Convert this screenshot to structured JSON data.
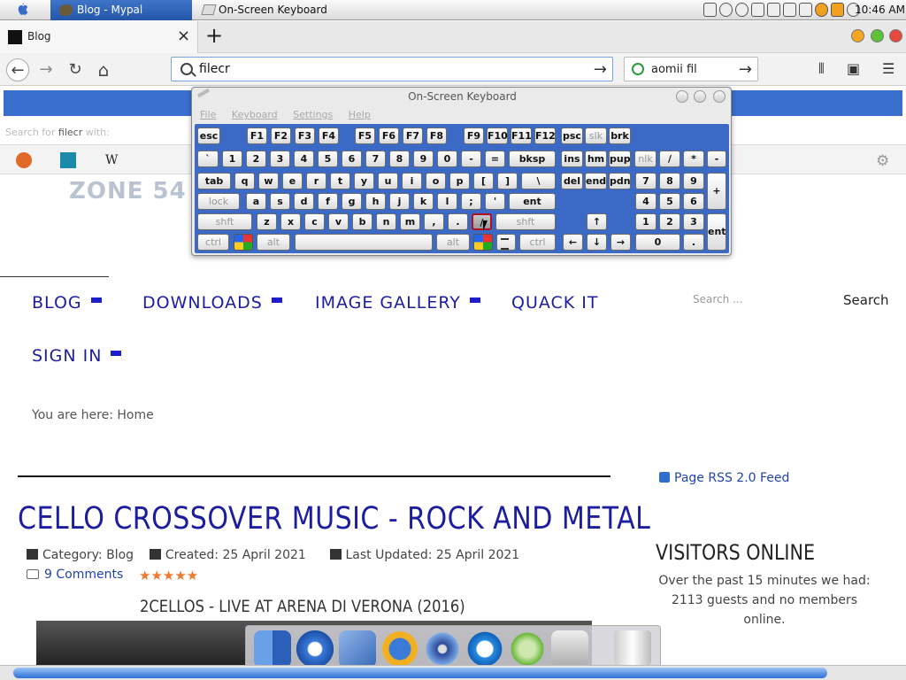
{
  "menubar": {
    "task_browser": "Blog - Mypal",
    "task_keyboard": "On-Screen Keyboard",
    "clock": "10:46 AM"
  },
  "tabbar": {
    "tab_title": "Blog",
    "close": "×",
    "new_tab": "+"
  },
  "navbar": {
    "url_value": "filecr",
    "search_value": "aomii fil",
    "go": "→",
    "back": "←",
    "forward": "→",
    "reload": "↻",
    "home": "⌂",
    "library": "⫴",
    "sidebar": "▣",
    "menu": "☰"
  },
  "dropdown": {
    "hint_prefix": "Search for ",
    "hint_query": "filecr",
    "hint_suffix": " with:",
    "engines": [
      "duckduckgo-icon",
      "bing-icon",
      "wikipedia-icon"
    ],
    "wiki_glyph": "W",
    "settings_glyph": "⚙"
  },
  "page": {
    "logo_text": "ZONE 54",
    "menu": [
      {
        "label": "BLOG"
      },
      {
        "label": "DOWNLOADS"
      },
      {
        "label": "IMAGE GALLERY"
      },
      {
        "label": "QUACK IT"
      },
      {
        "label": "SIGN IN"
      }
    ],
    "search_placeholder": "Search ...",
    "search_button": "Search",
    "breadcrumb": "You are here:  Home",
    "article_title": "CELLO CROSSOVER MUSIC - ROCK AND METAL",
    "meta_category_label": "Category:",
    "meta_category": "Blog",
    "meta_created": "Created: 25 April 2021",
    "meta_updated": "Last Updated: 25 April 2021",
    "comments": "9 Comments",
    "rating_stars": "★★★★★",
    "rating": 5,
    "video_title": "2CELLOS - LIVE AT ARENA DI VERONA (2016)",
    "rss": "Page RSS 2.0 Feed",
    "visitors_title": "VISITORS ONLINE",
    "visitors_text": "Over the past 15 minutes we had: 2113 guests and no members online."
  },
  "osk": {
    "title": "On-Screen Keyboard",
    "menu": [
      "File",
      "Keyboard",
      "Settings",
      "Help"
    ],
    "keys": {
      "esc": "esc",
      "f1": "F1",
      "f2": "F2",
      "f3": "F3",
      "f4": "F4",
      "f5": "F5",
      "f6": "F6",
      "f7": "F7",
      "f8": "F8",
      "f9": "F9",
      "f10": "F10",
      "f11": "F11",
      "f12": "F12",
      "psc": "psc",
      "slk": "slk",
      "brk": "brk",
      "grave": "`",
      "n1": "1",
      "n2": "2",
      "n3": "3",
      "n4": "4",
      "n5": "5",
      "n6": "6",
      "n7": "7",
      "n8": "8",
      "n9": "9",
      "n0": "0",
      "minus": "-",
      "equals": "=",
      "bksp": "bksp",
      "ins": "ins",
      "hm": "hm",
      "pup": "pup",
      "nlk": "nlk",
      "kp_div": "/",
      "kp_mul": "*",
      "kp_minus": "-",
      "tab": "tab",
      "q": "q",
      "w": "w",
      "e": "e",
      "r": "r",
      "t": "t",
      "y": "y",
      "u": "u",
      "i": "i",
      "o": "o",
      "p": "p",
      "lbr": "[",
      "rbr": "]",
      "bslash": "\\",
      "del": "del",
      "end": "end",
      "pdn": "pdn",
      "kp7": "7",
      "kp8": "8",
      "kp9": "9",
      "kp_plus": "+",
      "lock": "lock",
      "a": "a",
      "s": "s",
      "d": "d",
      "f": "f",
      "g": "g",
      "h": "h",
      "j": "j",
      "k": "k",
      "l": "l",
      "semi": ";",
      "quote": "'",
      "ent": "ent",
      "kp4": "4",
      "kp5": "5",
      "kp6": "6",
      "shft": "shft",
      "z": "z",
      "x": "x",
      "c": "c",
      "v": "v",
      "b": "b",
      "n": "n",
      "m": "m",
      "comma": ",",
      "period": ".",
      "slash": "/",
      "shft_r": "shft",
      "up": "↑",
      "kp1": "1",
      "kp2": "2",
      "kp3": "3",
      "ctrl": "ctrl",
      "alt": "alt",
      "alt_r": "alt",
      "ctrl_r": "ctrl",
      "left": "←",
      "down": "↓",
      "right": "→",
      "kp0": "0",
      "kp_dot": ".",
      "kp_ent": "ent"
    }
  }
}
